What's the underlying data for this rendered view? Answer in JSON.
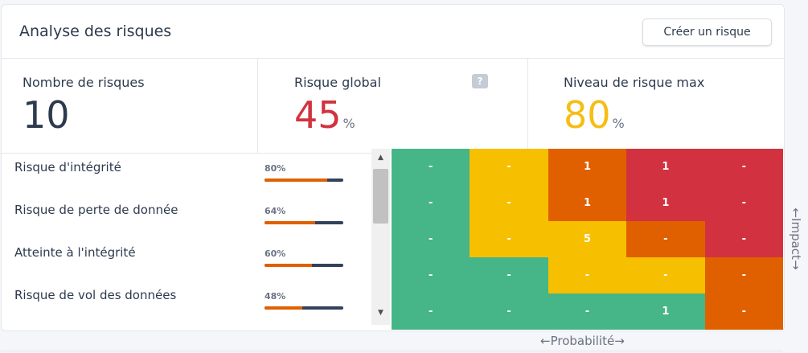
{
  "header": {
    "title": "Analyse des risques",
    "create_label": "Créer un risque"
  },
  "stats": [
    {
      "label": "Nombre de risques",
      "value": "10",
      "unit": "",
      "color": "#2d3a4e"
    },
    {
      "label": "Risque global",
      "value": "45",
      "unit": "%",
      "color": "#d2323f",
      "help": "?"
    },
    {
      "label": "Niveau de risque max",
      "value": "80",
      "unit": "%",
      "color": "#f6bd16"
    }
  ],
  "risks": [
    {
      "name": "Risque d'intégrité",
      "pct": "80%",
      "level": 0.8
    },
    {
      "name": "Risque de perte de donnée",
      "pct": "64%",
      "level": 0.64
    },
    {
      "name": "Atteinte à l'intégrité",
      "pct": "60%",
      "level": 0.6
    },
    {
      "name": "Risque de vol des données",
      "pct": "48%",
      "level": 0.48
    }
  ],
  "colors": {
    "green": "#46b588",
    "yellow": "#f6c000",
    "orange": "#e06000",
    "red": "#d2323f"
  },
  "matrix": [
    [
      {
        "v": "-",
        "c": "green"
      },
      {
        "v": "-",
        "c": "yellow"
      },
      {
        "v": "1",
        "c": "orange"
      },
      {
        "v": "1",
        "c": "red"
      },
      {
        "v": "-",
        "c": "red"
      }
    ],
    [
      {
        "v": "-",
        "c": "green"
      },
      {
        "v": "-",
        "c": "yellow"
      },
      {
        "v": "1",
        "c": "orange"
      },
      {
        "v": "1",
        "c": "red"
      },
      {
        "v": "-",
        "c": "red"
      }
    ],
    [
      {
        "v": "-",
        "c": "green"
      },
      {
        "v": "-",
        "c": "yellow"
      },
      {
        "v": "5",
        "c": "yellow"
      },
      {
        "v": "-",
        "c": "orange"
      },
      {
        "v": "-",
        "c": "red"
      }
    ],
    [
      {
        "v": "-",
        "c": "green"
      },
      {
        "v": "-",
        "c": "green"
      },
      {
        "v": "-",
        "c": "yellow"
      },
      {
        "v": "-",
        "c": "yellow"
      },
      {
        "v": "-",
        "c": "orange"
      }
    ],
    [
      {
        "v": "-",
        "c": "green"
      },
      {
        "v": "-",
        "c": "green"
      },
      {
        "v": "-",
        "c": "green"
      },
      {
        "v": "1",
        "c": "green"
      },
      {
        "v": "-",
        "c": "orange"
      }
    ]
  ],
  "axes": {
    "impact": "←Impact→",
    "probability": "←Probabilité→"
  }
}
